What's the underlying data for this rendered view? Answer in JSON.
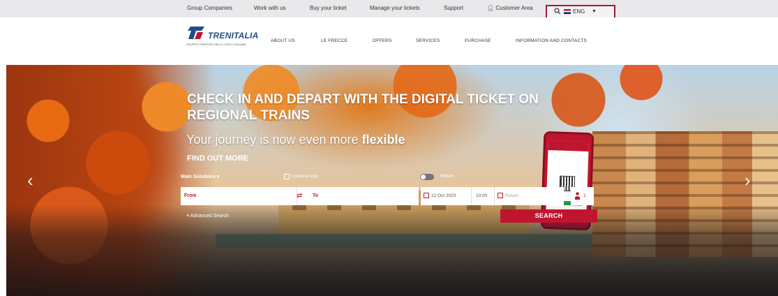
{
  "utility_bar": {
    "links": [
      "Group Companies",
      "Work with us",
      "Buy your ticket",
      "Manage your tickets",
      "Support",
      "Customer Area"
    ],
    "language": "ENG",
    "icons": [
      "search-icon",
      "uk-flag-icon",
      "caret-down-icon",
      "user-icon"
    ]
  },
  "header": {
    "logo_text": "TRENITALIA",
    "logo_tagline": "GRUPPO FERROVIE DELLO STATO ITALIANE",
    "nav": [
      "ABOUT US",
      "LE FRECCE",
      "OFFERS",
      "SERVICES",
      "PURCHASE",
      "INFORMATION AND CONTACTS"
    ]
  },
  "hero": {
    "headline": "CHECK IN AND DEPART WITH THE DIGITAL TICKET ON REGIONAL TRAINS",
    "subtitle_prefix": "Your journey is now even more ",
    "subtitle_bold": "flexible",
    "cta": "FIND OUT MORE",
    "prev_arrow": "‹",
    "next_arrow": "›"
  },
  "search": {
    "main_solutions": "Main Solutions ▾",
    "lowcost_label": "Lowcost only",
    "return_label": "Return",
    "from_label": "From",
    "to_label": "To",
    "date_value": "12 Oct 2023",
    "time_value": "10:00",
    "return_placeholder": "Return",
    "passengers": "1",
    "advanced_search": "Advanced Search",
    "search_button": "SEARCH"
  },
  "colors": {
    "brand_red": "#c0152f",
    "logo_blue": "#1f4d89",
    "lang_border": "#9d1c3a"
  }
}
